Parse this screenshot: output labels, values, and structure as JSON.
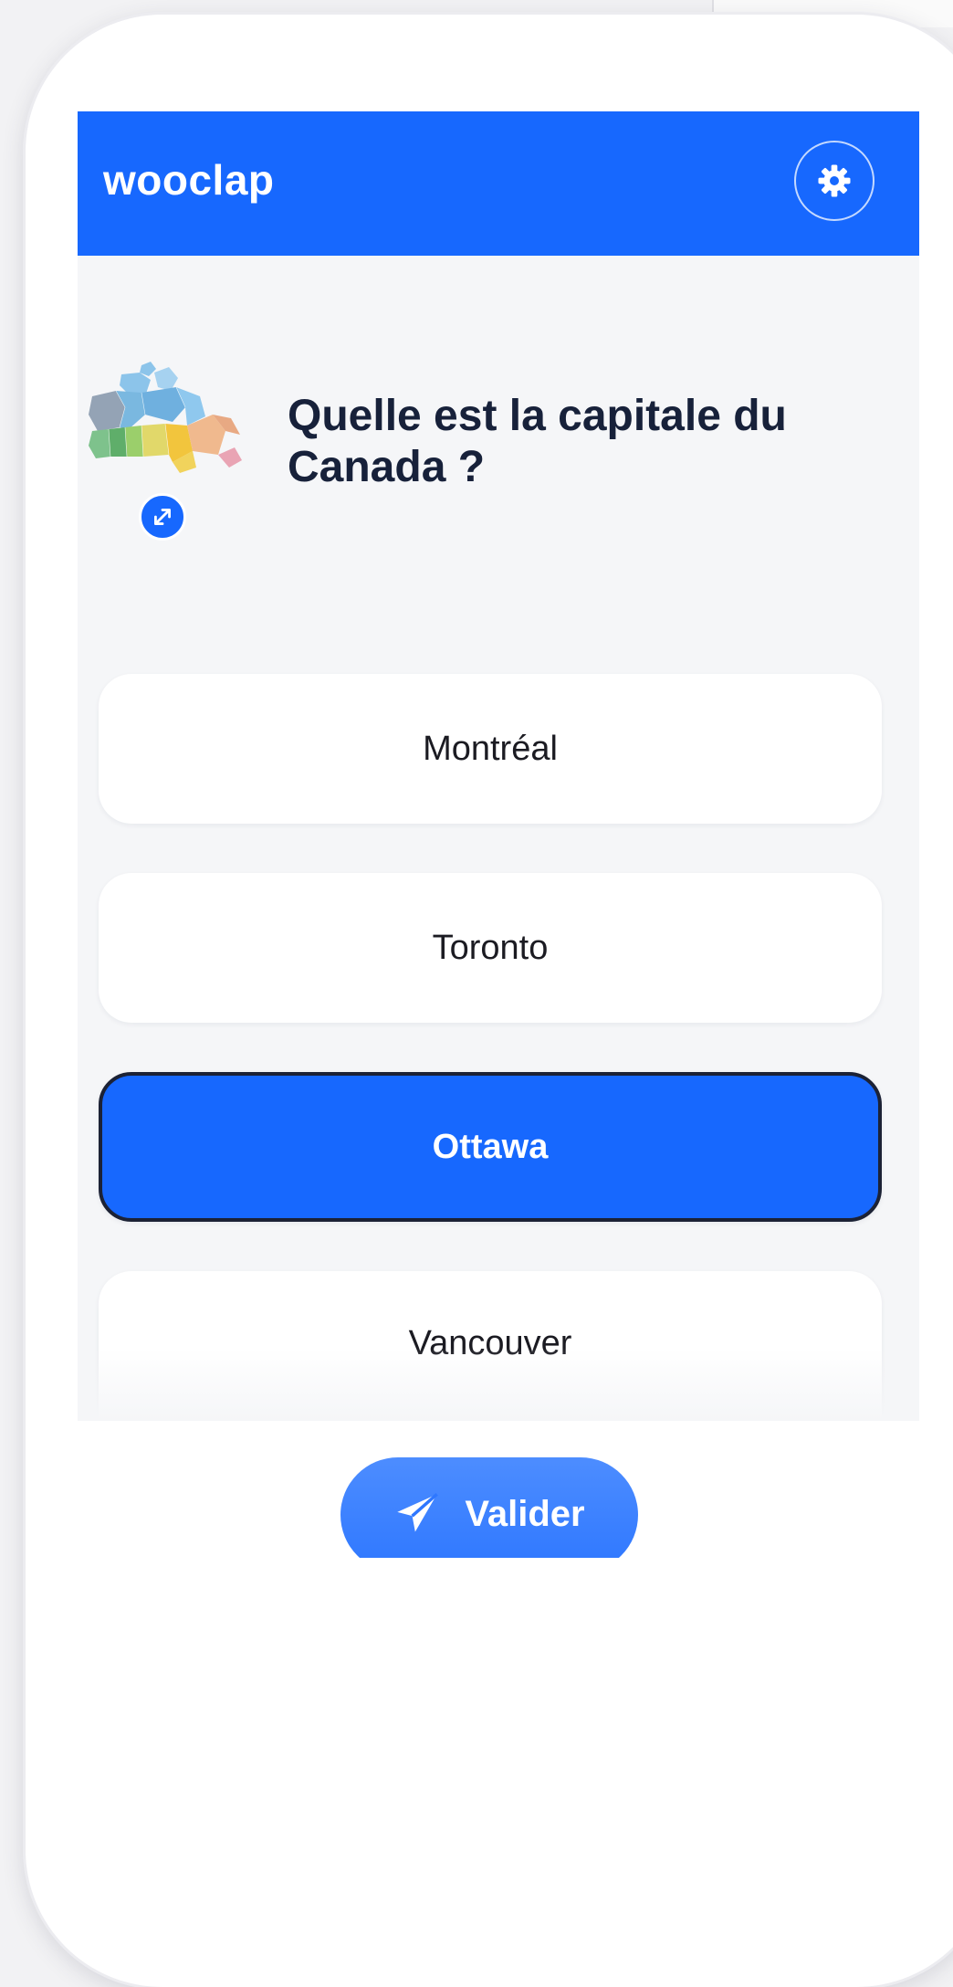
{
  "app": {
    "logo": "wooclap",
    "brand_color": "#1768fe"
  },
  "header": {
    "settings_icon": "gear-icon"
  },
  "question": {
    "text": "Quelle est la capitale du Canada ?",
    "image_icon": "canada-map-image",
    "expand_icon": "expand-icon"
  },
  "answers": [
    {
      "label": "Montréal",
      "selected": false
    },
    {
      "label": "Toronto",
      "selected": false
    },
    {
      "label": "Ottawa",
      "selected": true
    },
    {
      "label": "Vancouver",
      "selected": false
    }
  ],
  "submit": {
    "label": "Valider",
    "icon": "paper-plane-icon"
  }
}
